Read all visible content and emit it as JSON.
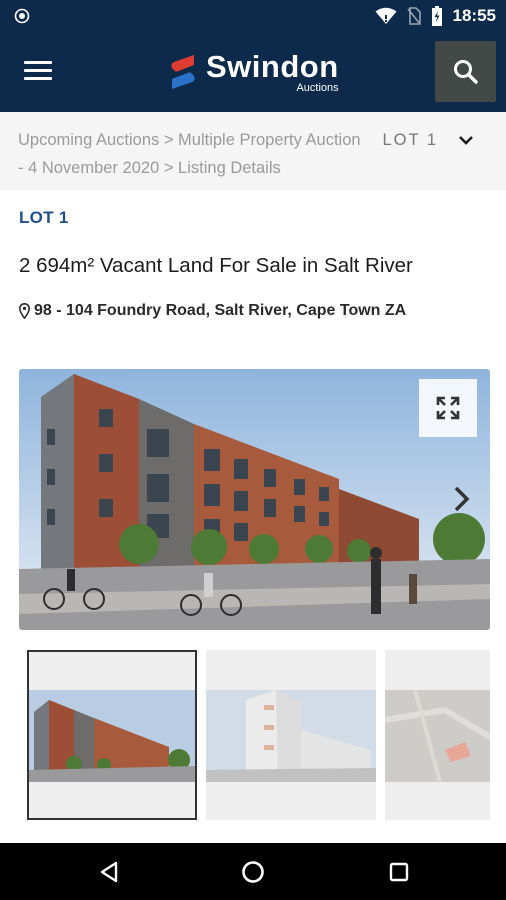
{
  "status_bar": {
    "time": "18:55",
    "icons": [
      "shield-icon",
      "wifi-icon",
      "no-sim-icon",
      "battery-charging-icon"
    ]
  },
  "app_bar": {
    "menu_icon": "hamburger-menu-icon",
    "logo_name": "Swindon",
    "logo_sub": "Auctions",
    "search_icon": "search-icon",
    "colors": {
      "background": "#0e2a4a",
      "search_button": "#434947",
      "logo_red": "#e03c31",
      "logo_blue": "#2a73c9"
    }
  },
  "breadcrumb": {
    "text": "Upcoming Auctions > Multiple Property Auction - 4 November 2020 > Listing Details",
    "lot_selector": "LOT 1",
    "dropdown_icon": "chevron-down-icon"
  },
  "listing": {
    "lot_label": "LOT 1",
    "title": "2 694m² Vacant Land For Sale in Salt River",
    "address": "98 - 104 Foundry Road, Salt River, Cape Town ZA",
    "address_icon": "map-pin-icon",
    "accent_color": "#1f4f8f"
  },
  "gallery": {
    "expand_icon": "expand-icon",
    "next_icon": "chevron-right-icon",
    "thumbnails": [
      "building-render",
      "apartment-tower-render",
      "site-map-aerial"
    ],
    "selected_index": 0
  },
  "nav_bar": {
    "icons": [
      "back-triangle-icon",
      "home-circle-icon",
      "recents-square-icon"
    ]
  }
}
